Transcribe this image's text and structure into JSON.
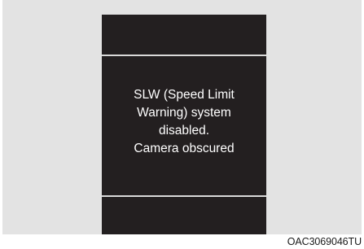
{
  "display": {
    "message_lines": [
      "SLW (Speed Limit",
      "Warning) system",
      "disabled.",
      "Camera obscured"
    ]
  },
  "figure": {
    "code": "OAC3069046TU"
  },
  "colors": {
    "screen_background": "#231f20",
    "frame_background": "#e3e3e3",
    "divider": "#d9d9d9",
    "text": "#ffffff"
  }
}
